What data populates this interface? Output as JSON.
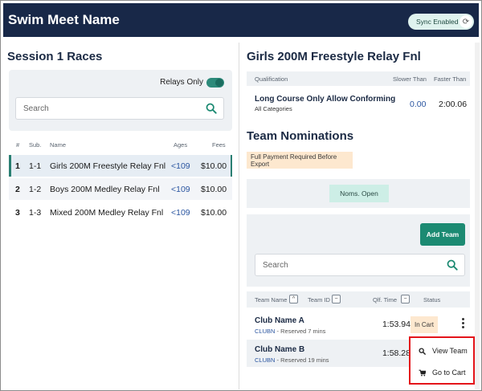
{
  "header": {
    "title": "Swim Meet Name",
    "sync_label": "Sync Enabled"
  },
  "races": {
    "title": "Session 1 Races",
    "relays_only_label": "Relays Only",
    "search_placeholder": "Search",
    "columns": {
      "num": "#",
      "sub": "Sub.",
      "name": "Name",
      "ages": "Ages",
      "fees": "Fees"
    },
    "rows": [
      {
        "num": "1",
        "sub": "1-1",
        "name": "Girls 200M Freestyle Relay Fnl",
        "ages": "<109",
        "fee": "$10.00"
      },
      {
        "num": "2",
        "sub": "1-2",
        "name": "Boys 200M Medley Relay Fnl",
        "ages": "<109",
        "fee": "$10.00"
      },
      {
        "num": "3",
        "sub": "1-3",
        "name": "Mixed 200M Medley Relay Fnl",
        "ages": "<109",
        "fee": "$10.00"
      }
    ]
  },
  "event": {
    "title": "Girls 200M Freestyle Relay Fnl",
    "qual_columns": {
      "qualification": "Qualification",
      "slower": "Slower Than",
      "faster": "Faster Than"
    },
    "qual_row": {
      "name": "Long Course Only Allow Conforming",
      "category": "All Categories",
      "slower": "0.00",
      "faster": "2:00.06"
    }
  },
  "nominations": {
    "title": "Team Nominations",
    "notice": "Full Payment Required Before Export",
    "status_chip": "Noms. Open",
    "add_team_label": "Add Team",
    "search_placeholder": "Search",
    "columns": {
      "team_name": "Team Name",
      "team_id": "Team ID",
      "qlf_time": "Qlf. Time",
      "status": "Status"
    },
    "teams": [
      {
        "name": "Club Name A",
        "id": "CLUBN",
        "reserved": " - Reserved 7 mins",
        "time": "1:53.94",
        "status": "In Cart"
      },
      {
        "name": "Club Name B",
        "id": "CLUBN",
        "reserved": " - Reserved 19 mins",
        "time": "1:58.28",
        "status": ""
      }
    ]
  },
  "context_menu": {
    "view_team": "View Team",
    "go_to_cart": "Go to Cart"
  },
  "colors": {
    "header_bg": "#182848",
    "accent": "#1c8a72",
    "highlight": "#e4141a"
  }
}
